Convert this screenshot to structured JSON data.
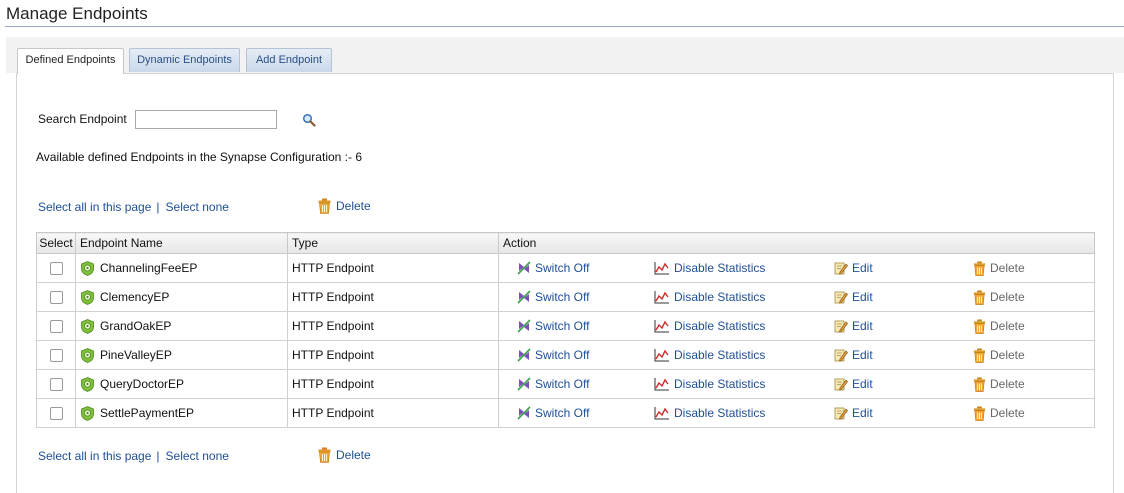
{
  "page": {
    "title": "Manage Endpoints"
  },
  "tabs": [
    {
      "label": "Defined Endpoints",
      "active": true
    },
    {
      "label": "Dynamic Endpoints",
      "active": false
    },
    {
      "label": "Add Endpoint",
      "active": false
    }
  ],
  "search": {
    "label": "Search Endpoint",
    "value": "",
    "placeholder": ""
  },
  "summary": "Available defined Endpoints in the Synapse Configuration :- 6",
  "bulk": {
    "select_all": "Select all in this page",
    "separator": "|",
    "select_none": "Select none",
    "delete": "Delete"
  },
  "table": {
    "headers": {
      "select": "Select",
      "name": "Endpoint Name",
      "type": "Type",
      "action": "Action"
    },
    "rows": [
      {
        "name": "ChannelingFeeEP",
        "type": "HTTP Endpoint"
      },
      {
        "name": "ClemencyEP",
        "type": "HTTP Endpoint"
      },
      {
        "name": "GrandOakEP",
        "type": "HTTP Endpoint"
      },
      {
        "name": "PineValleyEP",
        "type": "HTTP Endpoint"
      },
      {
        "name": "QueryDoctorEP",
        "type": "HTTP Endpoint"
      },
      {
        "name": "SettlePaymentEP",
        "type": "HTTP Endpoint"
      }
    ],
    "actions": {
      "switch": "Switch Off",
      "stats": "Disable Statistics",
      "edit": "Edit",
      "delete": "Delete"
    }
  },
  "colors": {
    "link": "#1e4f95",
    "tab_text": "#2a4f84",
    "title_rule": "#9aa7c4"
  },
  "icons": {
    "search": "magnifier-icon",
    "delete": "trash-icon",
    "endpoint": "endpoint-gear-icon",
    "switch": "switch-off-icon",
    "stats": "statistics-chart-icon",
    "edit": "edit-pencil-icon"
  }
}
